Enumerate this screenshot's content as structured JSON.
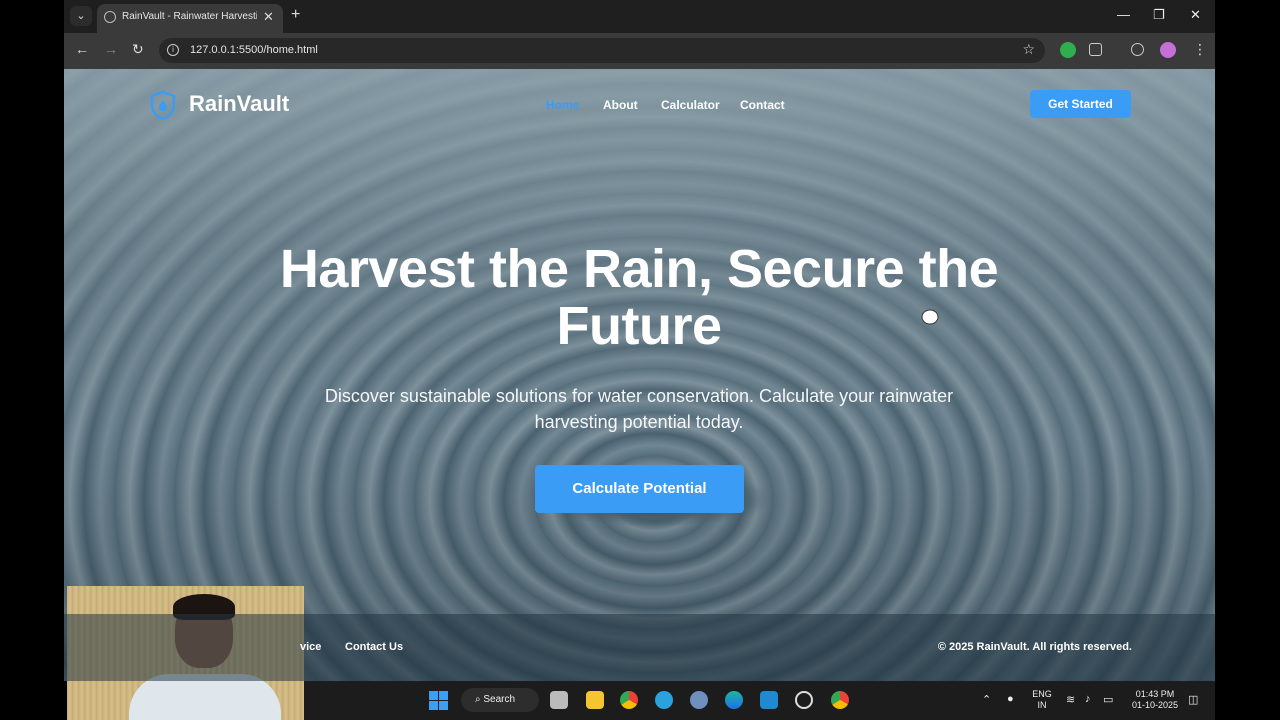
{
  "browser": {
    "tab_title": "RainVault - Rainwater Harvesting",
    "tab_close": "✕",
    "new_tab": "+",
    "url": "127.0.0.1:5500/home.html",
    "window_controls": [
      "—",
      "❐",
      "✕"
    ],
    "nav_icons": [
      "←",
      "→",
      "↻"
    ]
  },
  "site": {
    "brand": "RainVault",
    "nav": [
      {
        "label": "Home",
        "active": true
      },
      {
        "label": "About",
        "active": false
      },
      {
        "label": "Calculator",
        "active": false
      },
      {
        "label": "Contact",
        "active": false
      }
    ],
    "cta_label": "Get Started"
  },
  "hero": {
    "title": "Harvest the Rain, Secure the Future",
    "subtitle": "Discover sustainable solutions for water conservation. Calculate your rainwater harvesting potential today.",
    "button": "Calculate Potential"
  },
  "footer": {
    "links": [
      "vice",
      "Contact Us"
    ],
    "copyright": "© 2025 RainVault. All rights reserved."
  },
  "taskbar": {
    "search": "Search",
    "lang_1": "ENG",
    "lang_2": "IN",
    "time": "01:43 PM",
    "date": "01-10-2025"
  },
  "colors": {
    "accent": "#3b9cf5",
    "chrome_dark": "#1f1f1f",
    "chrome_toolbar": "#3a3a3a"
  }
}
